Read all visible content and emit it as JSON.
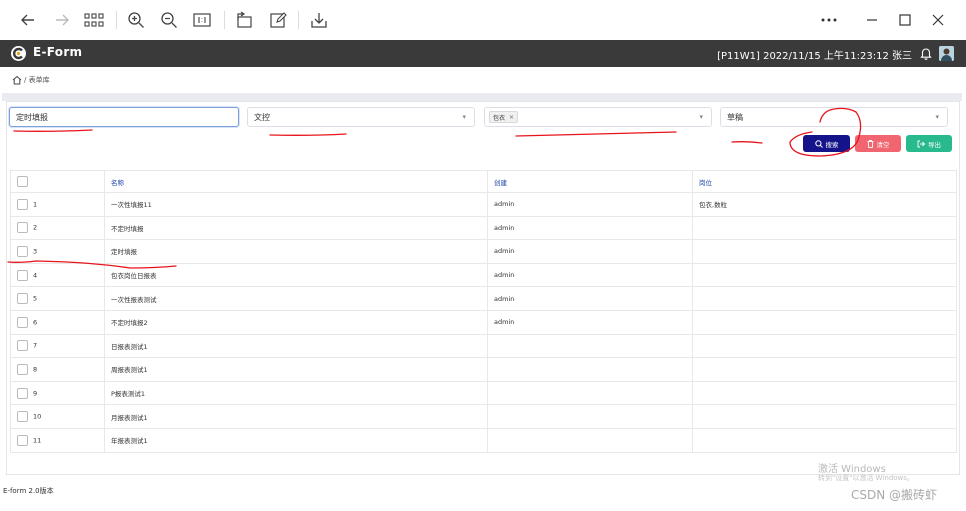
{
  "header": {
    "app_title": "E-Form",
    "user_info": "[P11W1] 2022/11/15 上午11:23:12 张三"
  },
  "breadcrumb": {
    "path": "/ 表单库"
  },
  "filters": {
    "name_value": "定时填报",
    "type_value": "文控",
    "position_tag": "包衣",
    "position_tag_remove": "×",
    "status_value": "草稿"
  },
  "buttons": {
    "search": "搜索",
    "clear": "清空",
    "export": "导出"
  },
  "table": {
    "columns": [
      "名称",
      "创建",
      "岗位"
    ],
    "rows": [
      {
        "no": "1",
        "name": "一次性填报11",
        "creator": "admin",
        "post": "包衣,数粒"
      },
      {
        "no": "2",
        "name": "不定时填报",
        "creator": "admin",
        "post": ""
      },
      {
        "no": "3",
        "name": "定时填报",
        "creator": "admin",
        "post": ""
      },
      {
        "no": "4",
        "name": "包衣岗位日报表",
        "creator": "admin",
        "post": ""
      },
      {
        "no": "5",
        "name": "一次性报表测试",
        "creator": "admin",
        "post": ""
      },
      {
        "no": "6",
        "name": "不定时填报2",
        "creator": "admin",
        "post": ""
      },
      {
        "no": "7",
        "name": "日报表测试1",
        "creator": "",
        "post": ""
      },
      {
        "no": "8",
        "name": "周报表测试1",
        "creator": "",
        "post": ""
      },
      {
        "no": "9",
        "name": "P报表测试1",
        "creator": "",
        "post": ""
      },
      {
        "no": "10",
        "name": "月报表测试1",
        "creator": "",
        "post": ""
      },
      {
        "no": "11",
        "name": "年报表测试1",
        "creator": "",
        "post": ""
      }
    ]
  },
  "footer": {
    "version": "E-form 2.0版本"
  },
  "watermark": {
    "activate_title": "激活 Windows",
    "activate_sub": "转到\"设置\"以激活 Windows。",
    "csdn": "CSDN @搬砖虾"
  },
  "colors": {
    "header_bg": "#3a3a3a",
    "search_btn": "#14138a",
    "clear_btn": "#f06570",
    "export_btn": "#28b98c",
    "annotation": "#e8141c",
    "column_header_text": "#1b3fa6"
  },
  "icons": [
    "back-icon",
    "forward-icon",
    "grid-icon",
    "zoom-in-icon",
    "zoom-out-icon",
    "actual-size-icon",
    "rotate-icon",
    "edit-icon",
    "download-icon",
    "more-icon",
    "minimize-icon",
    "maximize-icon",
    "close-icon",
    "logo-icon",
    "bell-icon",
    "home-icon",
    "search-icon",
    "trash-icon",
    "export-icon"
  ]
}
